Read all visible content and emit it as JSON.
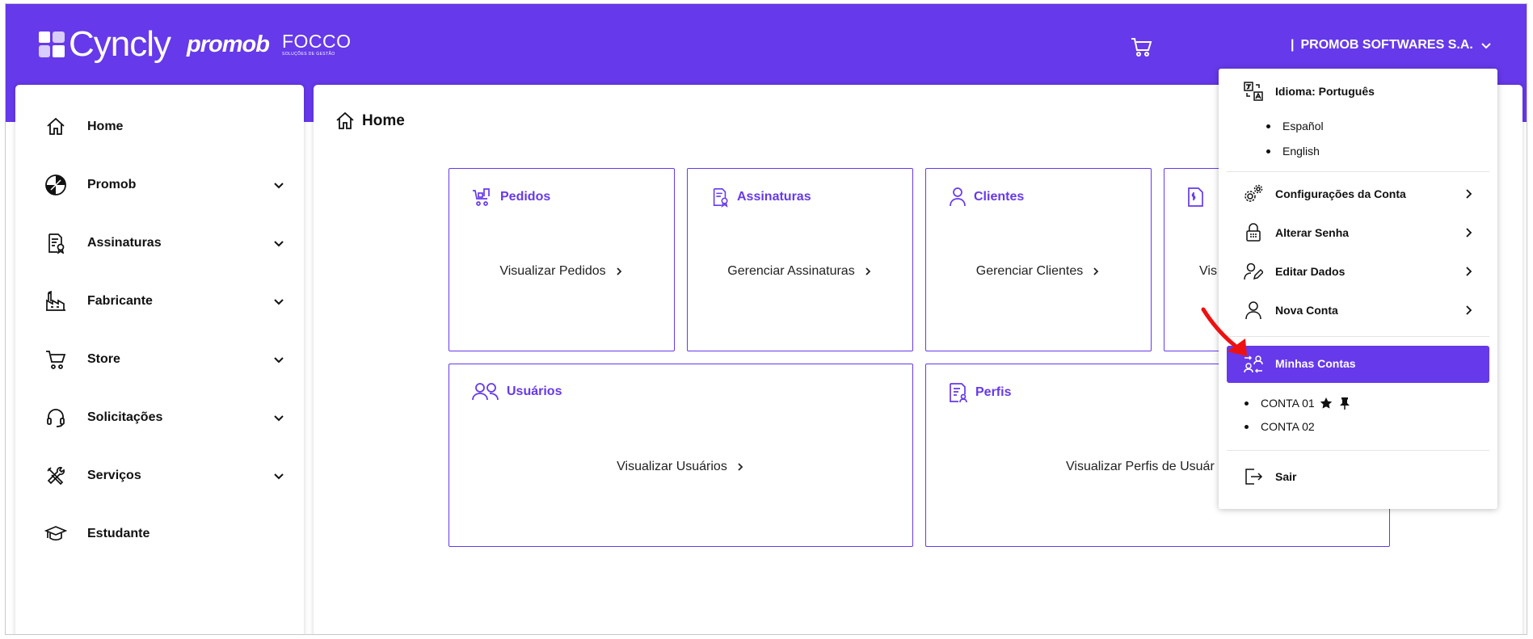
{
  "brand": {
    "logo": "Cyncly",
    "promob": "promob",
    "focco": "FOCCO",
    "focco_tag": "SOLUÇÕES DE GESTÃO"
  },
  "header": {
    "company": "PROMOB SOFTWARES S.A.",
    "separator": "|"
  },
  "sidebar": {
    "items": [
      {
        "label": "Home",
        "icon": "home-icon",
        "expandable": false
      },
      {
        "label": "Promob",
        "icon": "promob-logo-icon",
        "expandable": true
      },
      {
        "label": "Assinaturas",
        "icon": "document-badge-icon",
        "expandable": true
      },
      {
        "label": "Fabricante",
        "icon": "factory-icon",
        "expandable": true
      },
      {
        "label": "Store",
        "icon": "cart-icon",
        "expandable": true
      },
      {
        "label": "Solicitações",
        "icon": "headset-icon",
        "expandable": true
      },
      {
        "label": "Serviços",
        "icon": "tools-icon",
        "expandable": true
      },
      {
        "label": "Estudante",
        "icon": "graduation-cap-icon",
        "expandable": false
      }
    ]
  },
  "main": {
    "breadcrumb": "Home",
    "cards": [
      {
        "title": "Pedidos",
        "link": "Visualizar Pedidos",
        "icon": "cart-box-icon"
      },
      {
        "title": "Assinaturas",
        "link": "Gerenciar Assinaturas",
        "icon": "document-badge-icon"
      },
      {
        "title": "Clientes",
        "link": "Gerenciar Clientes",
        "icon": "person-icon"
      },
      {
        "title": "",
        "link": "Vis",
        "icon": "document-dollar-icon"
      },
      {
        "title": "Usuários",
        "link": "Visualizar Usuários",
        "icon": "users-icon"
      },
      {
        "title": "Perfis",
        "link": "Visualizar Perfis de Usuár",
        "icon": "profile-document-icon"
      }
    ]
  },
  "dropdown": {
    "language_label": "Idioma: Português",
    "languages": [
      "Español",
      "English"
    ],
    "items": [
      {
        "label": "Configurações da Conta",
        "icon": "gears-icon"
      },
      {
        "label": "Alterar Senha",
        "icon": "lock-icon"
      },
      {
        "label": "Editar Dados",
        "icon": "user-edit-icon"
      },
      {
        "label": "Nova Conta",
        "icon": "person-icon"
      }
    ],
    "active": {
      "label": "Minhas Contas",
      "icon": "switch-accounts-icon"
    },
    "accounts": [
      "CONTA 01",
      "CONTA 02"
    ],
    "logout": "Sair"
  },
  "colors": {
    "brand": "#6639ea",
    "annotation_arrow": "#ee1111"
  }
}
